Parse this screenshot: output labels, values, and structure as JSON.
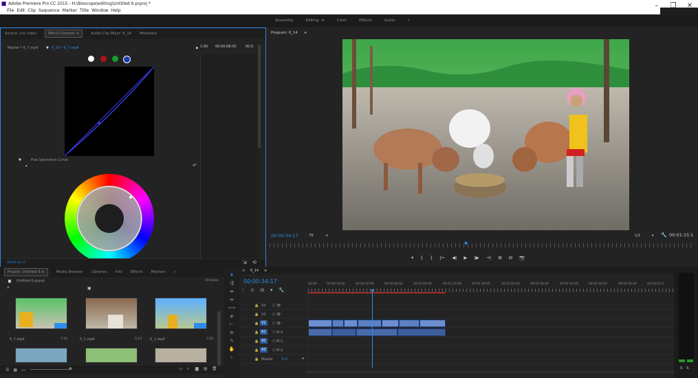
{
  "window": {
    "title": "Adobe Premiere Pro CC 2015 - H:\\Bioscope\\editing\\Untitled 6.prproj *",
    "minimize": "–",
    "maximize": "❐",
    "close": "✕"
  },
  "menu": [
    "File",
    "Edit",
    "Clip",
    "Sequence",
    "Marker",
    "Title",
    "Window",
    "Help"
  ],
  "workspaces": [
    "Assembly",
    "Editing",
    "≡",
    "Color",
    "Effects",
    "Audio",
    "»"
  ],
  "source_panel": {
    "tabs": [
      "Source: (no clips)",
      "Effect Controls",
      "≡",
      "Audio Clip Mixer: 6_14",
      "Metadata"
    ],
    "master_label": "Master * 6_7.mp4",
    "clip_label": "6_14 * 6_7.mp4",
    "ruler_times": [
      "1:00",
      "00:00:08:00",
      "00:0"
    ],
    "curve_label": "Hue Saturation Curve",
    "timecode": "00:00:34:17"
  },
  "program_monitor": {
    "title": "Program: 6_14",
    "menu_icon": "≡",
    "timecode": "00:00:34:17",
    "fit": "Fit",
    "resolution": "1/2",
    "duration": "00:01:15:1",
    "transport": [
      "▾",
      "{",
      "}",
      "|←",
      "◀|",
      "▶",
      "|▶",
      "→|",
      "⊞",
      "⊟",
      "📷"
    ]
  },
  "project_panel": {
    "tabs": [
      "Project: Untitled 6",
      "≡",
      "Media Browser",
      "Libraries",
      "Info",
      "Effects",
      "Markers",
      "»"
    ],
    "project_file": "Untitled 6.prproj",
    "item_count": "15 Items",
    "search_placeholder": "",
    "items": [
      {
        "name": "6_7.mp4",
        "duration": "7:25"
      },
      {
        "name": "6_2.mp4",
        "duration": "5:14"
      },
      {
        "name": "6_1.mp4",
        "duration": "7:25"
      }
    ]
  },
  "timeline": {
    "tab": "6_14",
    "menu_icon": "≡",
    "timecode": "00:00:34:17",
    "ruler": [
      "00:00",
      "00:00:16:00",
      "00:00:32:00",
      "00:00:48:00",
      "00:01:04:00",
      "00:01:20:00",
      "00:01:36:00",
      "00:01:52:00",
      "00:02:08:00",
      "00:02:24:00",
      "00:02:40:00",
      "00:02:56:00",
      "00:03:12:0"
    ],
    "tracks": [
      {
        "label": "V3",
        "buttons": "☐ 👁"
      },
      {
        "label": "V2",
        "buttons": "☐ 👁"
      },
      {
        "label": "V1",
        "buttons": "☐ 👁"
      },
      {
        "label": "A1",
        "buttons": "☐ M S"
      },
      {
        "label": "A2",
        "buttons": "☐ M S"
      },
      {
        "label": "A3",
        "buttons": "☐ M S"
      }
    ],
    "master": {
      "label": "Master",
      "value": "0.0"
    }
  },
  "audio_meter": {
    "labels": [
      "S",
      "S"
    ]
  },
  "colors": {
    "accent": "#2d8ceb",
    "clip_video": "#5e7fc2",
    "clip_audio": "#4a6aa8",
    "playhead": "#2d8ceb"
  }
}
